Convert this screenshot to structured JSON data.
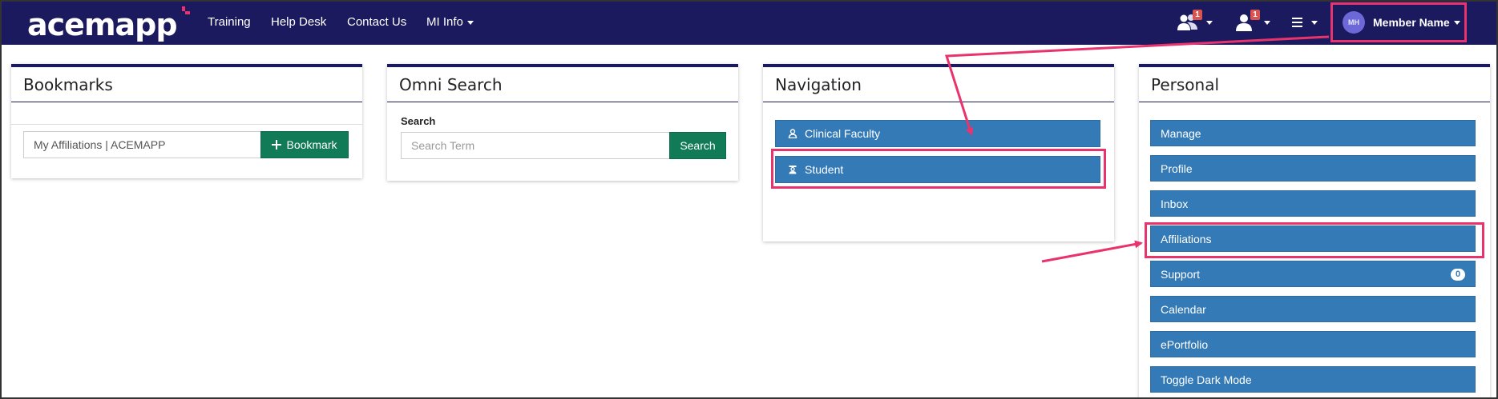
{
  "header": {
    "logo_text": "acemapp",
    "nav_links": [
      {
        "label": "Training"
      },
      {
        "label": "Help Desk"
      },
      {
        "label": "Contact Us"
      },
      {
        "label": "MI Info"
      }
    ],
    "notifications": [
      {
        "icon": "users-icon",
        "count": "1"
      },
      {
        "icon": "user-icon",
        "count": "1"
      }
    ],
    "menu_icon": "hamburger-icon",
    "user": {
      "initials": "MH",
      "name": "Member Name"
    }
  },
  "bookmarks": {
    "title": "Bookmarks",
    "input_value": "My Affiliations | ACEMAPP",
    "button_icon": "plus-icon",
    "button_label": "Bookmark"
  },
  "omni_search": {
    "title": "Omni Search",
    "label": "Search",
    "placeholder": "Search Term",
    "button_label": "Search"
  },
  "navigation": {
    "title": "Navigation",
    "items": [
      {
        "label": "Clinical Faculty",
        "icon": "faculty-icon"
      },
      {
        "label": "Student",
        "icon": "student-icon"
      }
    ]
  },
  "personal": {
    "title": "Personal",
    "items": [
      {
        "label": "Manage"
      },
      {
        "label": "Profile"
      },
      {
        "label": "Inbox"
      },
      {
        "label": "Affiliations"
      },
      {
        "label": "Support",
        "badge": "0"
      },
      {
        "label": "Calendar"
      },
      {
        "label": "ePortfolio"
      },
      {
        "label": "Toggle Dark Mode"
      }
    ]
  },
  "colors": {
    "navbar": "#1b1a5e",
    "primary_button": "#337ab7",
    "success_button": "#117a56",
    "highlight": "#e8336d",
    "badge": "#d9534f"
  }
}
